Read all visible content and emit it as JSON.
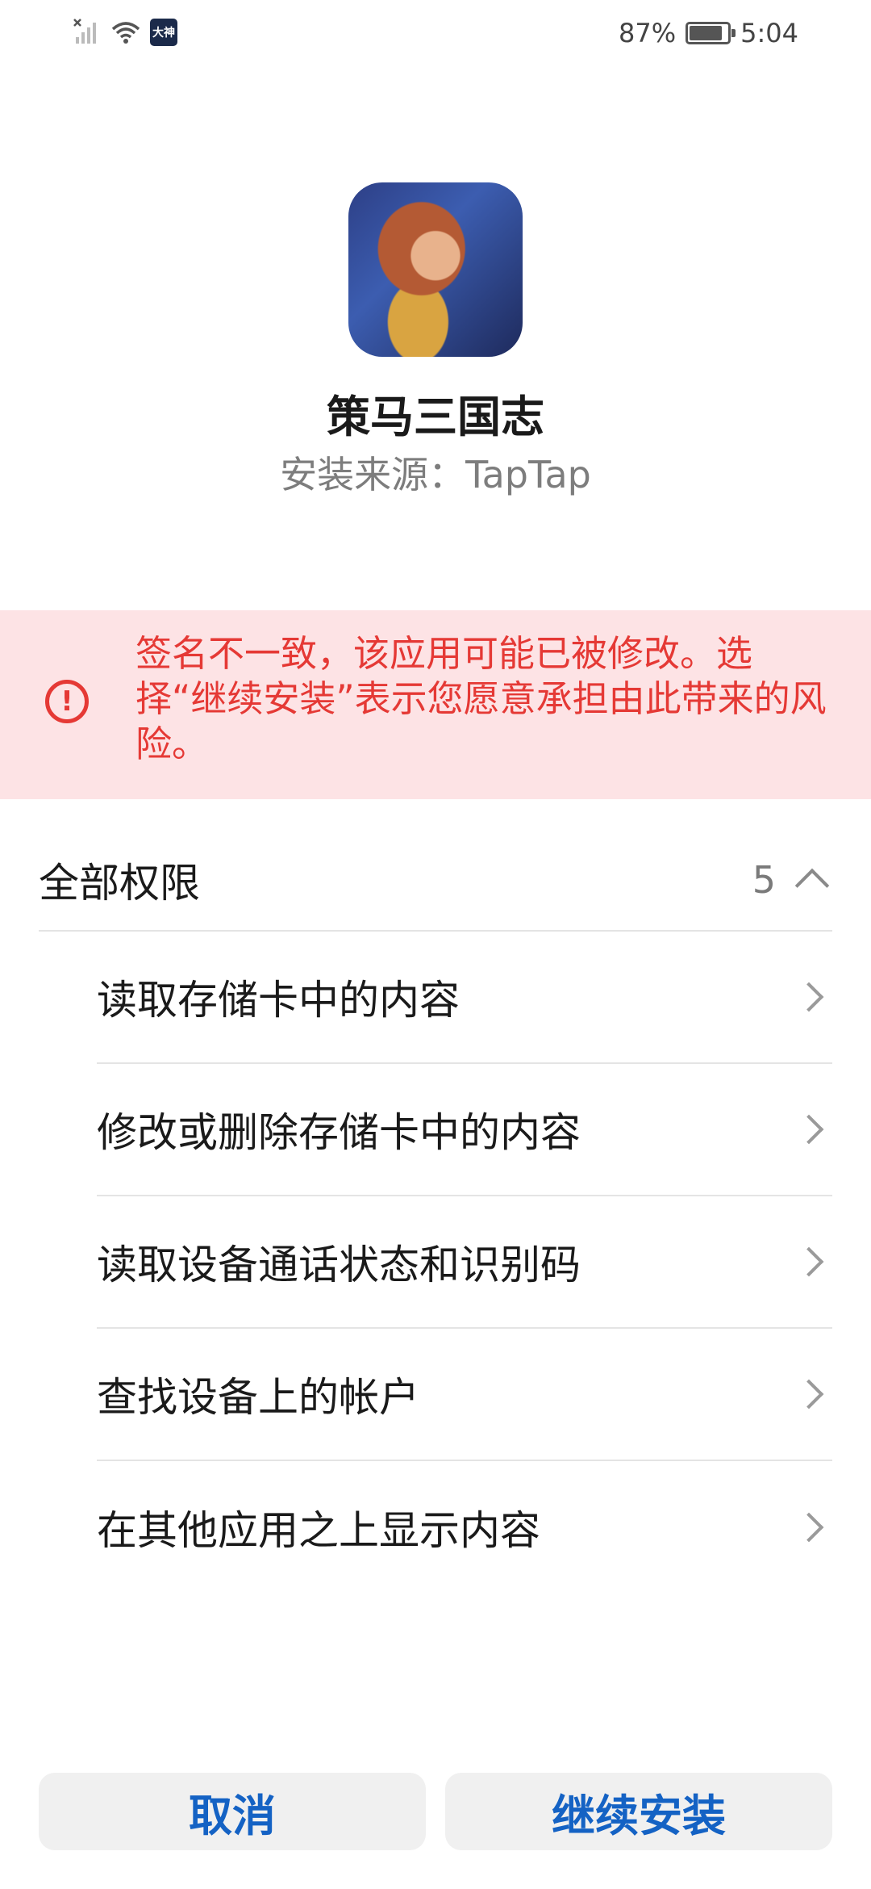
{
  "status_bar": {
    "carrier_badge": "大神",
    "battery_percent": "87%",
    "battery_level": 0.87,
    "time": "5:04",
    "icons": [
      "no-signal-icon",
      "wifi-icon",
      "battery-icon"
    ]
  },
  "app": {
    "name": "策马三国志",
    "source": "安装来源：TapTap"
  },
  "warning": {
    "icon": "exclamation-circle-icon",
    "text": "签名不一致，该应用可能已被修改。选择“继续安装”表示您愿意承担由此带来的风险。",
    "color": "#e53935",
    "background": "#fde3e5"
  },
  "permissions": {
    "title": "全部权限",
    "count": "5",
    "items": [
      {
        "label": "读取存储卡中的内容"
      },
      {
        "label": "修改或删除存储卡中的内容"
      },
      {
        "label": "读取设备通话状态和识别码"
      },
      {
        "label": "查找设备上的帐户"
      },
      {
        "label": "在其他应用之上显示内容"
      }
    ]
  },
  "buttons": {
    "cancel": "取消",
    "install": "继续安装",
    "accent": "#1462c4"
  }
}
